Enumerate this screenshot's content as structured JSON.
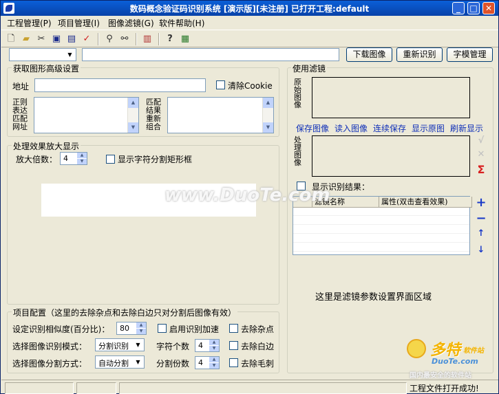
{
  "window": {
    "title": "数码概念验证码识别系统 [演示版][未注册] 已打开工程:default",
    "min_icon": "minimize-icon",
    "max_icon": "maximize-icon",
    "close_icon": "close-icon"
  },
  "menu": [
    "工程管理(P)",
    "项目管理(I)",
    "图像滤镜(G)",
    "软件帮助(H)"
  ],
  "toolbar": {
    "icons": [
      "new-file-icon",
      "open-folder-icon",
      "cut-icon",
      "save-icon",
      "save-as-icon",
      "check-icon",
      "binoculars-icon",
      "find-replace-icon",
      "chart-icon",
      "help-cursor-icon",
      "about-icon"
    ]
  },
  "top": {
    "url_combo_value": "",
    "url_input_value": "",
    "download_button": "下载图像",
    "reidentify_button": "重新识别",
    "charset_button": "字模管理"
  },
  "advanced": {
    "title": "获取图形高级设置",
    "address_label": "地址",
    "clear_cookie_label": "清除Cookie",
    "regex_label": "正则表达匹配网址",
    "match_label": "匹配结果重新组合"
  },
  "zoom": {
    "title": "处理效果放大显示",
    "zoom_label": "放大倍数：",
    "zoom_value": "4",
    "show_rect_label": "显示字符分割矩形框"
  },
  "project": {
    "title": "项目配置（这里的去除杂点和去除白边只对分割后图像有效）",
    "similarity_label": "设定识别相似度(百分比)：",
    "similarity_value": "80",
    "accelerate_label": "启用识别加速",
    "remove_noise_label": "去除杂点",
    "mode_label": "选择图像识别模式：",
    "mode_value": "分割识别",
    "char_count_label": "字符个数",
    "char_count_value": "4",
    "remove_border_label": "去除白边",
    "split_label": "选择图像分割方式：",
    "split_value": "自动分割",
    "split_count_label": "分割份数",
    "split_count_value": "4",
    "remove_burr_label": "去除毛刺"
  },
  "filters": {
    "title": "使用滤镜",
    "original_label": "原始图像",
    "processed_label": "处理图像",
    "links": [
      "保存图像",
      "读入图像",
      "连续保存",
      "显示原图",
      "刷新显示"
    ],
    "show_result_label": "显示识别结果：",
    "grid_headers": [
      "",
      "滤镜名称",
      "属性(双击查看效果)"
    ],
    "param_area_text": "这里是滤镜参数设置界面区域",
    "side_icons": [
      "apply-check-icon",
      "cancel-x-icon",
      "sigma-icon"
    ],
    "list_icons": [
      "add-plus-icon",
      "remove-minus-icon",
      "move-up-icon",
      "move-down-icon"
    ]
  },
  "status": {
    "message": "工程文件打开成功!"
  },
  "watermark": {
    "center": "www.DuoTe.com",
    "corner_title": "多特",
    "corner_sub": "软件站",
    "corner_domain": "DuoTe.com",
    "corner_slogan": "国内最安全的软件站"
  },
  "colors": {
    "titlebar": "#0842a8",
    "link": "#1030b8",
    "accent_blue": "#1a3ac8",
    "sigma_red": "#d82020"
  }
}
